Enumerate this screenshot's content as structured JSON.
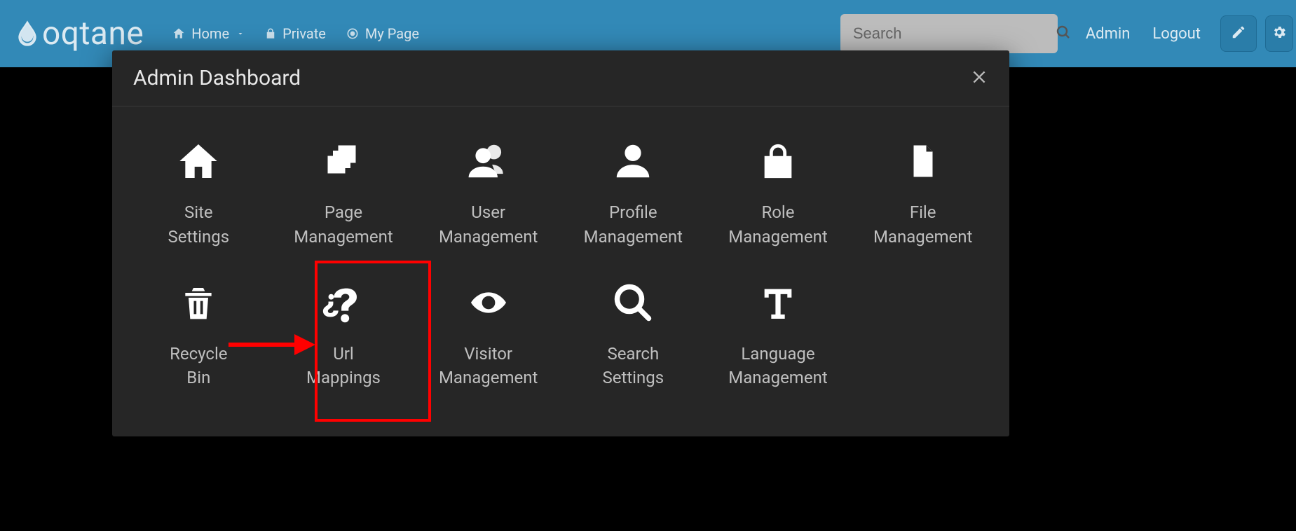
{
  "brand": {
    "name": "oqtane"
  },
  "nav": {
    "home": "Home",
    "private": "Private",
    "mypage": "My Page"
  },
  "search": {
    "placeholder": "Search"
  },
  "auth": {
    "admin": "Admin",
    "logout": "Logout"
  },
  "modal": {
    "title": "Admin Dashboard",
    "tiles": [
      {
        "label": "Site\nSettings"
      },
      {
        "label": "Page\nManagement"
      },
      {
        "label": "User\nManagement"
      },
      {
        "label": "Profile\nManagement"
      },
      {
        "label": "Role\nManagement"
      },
      {
        "label": "File\nManagement"
      },
      {
        "label": "Recycle\nBin"
      },
      {
        "label": "Url\nMappings"
      },
      {
        "label": "Visitor\nManagement"
      },
      {
        "label": "Search\nSettings"
      },
      {
        "label": "Language\nManagement"
      }
    ]
  },
  "annotation": {
    "highlight_tile_index": 7,
    "color": "#ff0000"
  }
}
